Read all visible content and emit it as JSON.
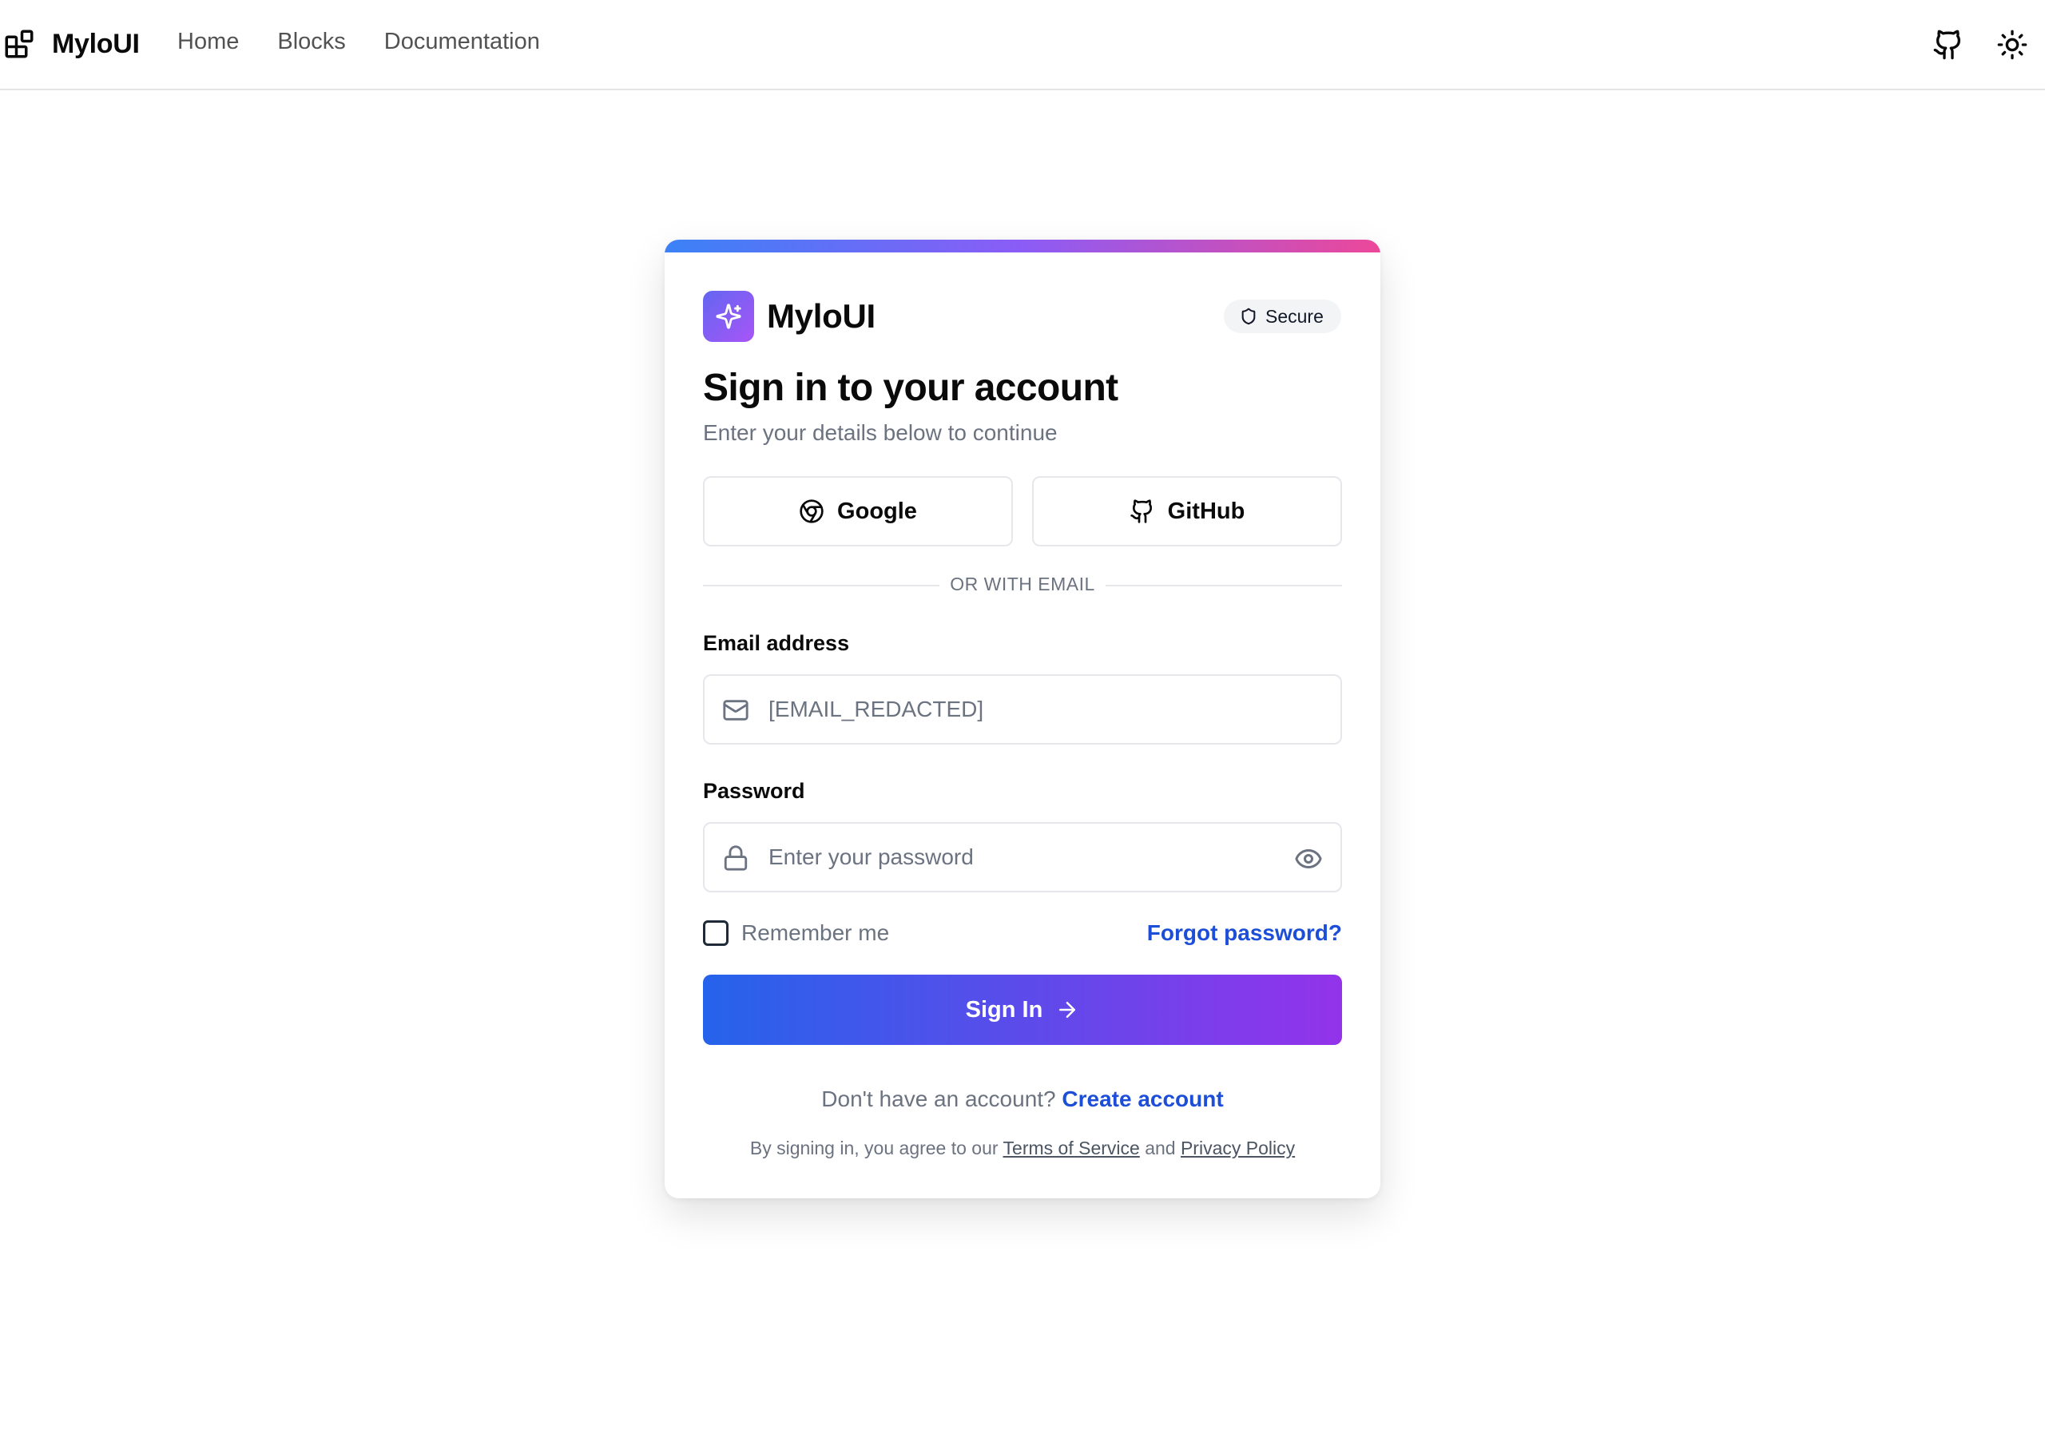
{
  "nav": {
    "brand": "MyloUI",
    "links": [
      "Home",
      "Blocks",
      "Documentation"
    ],
    "icons": {
      "github": "github-icon",
      "theme": "sun-icon"
    }
  },
  "card": {
    "brand": "MyloUI",
    "badge": "Secure",
    "title": "Sign in to your account",
    "subtitle": "Enter your details below to continue",
    "social": {
      "google": "Google",
      "github": "GitHub"
    },
    "divider": "OR WITH EMAIL",
    "email": {
      "label": "Email address",
      "value": "[EMAIL_REDACTED]"
    },
    "password": {
      "label": "Password",
      "placeholder": "Enter your password"
    },
    "remember": "Remember me",
    "forgot": "Forgot password?",
    "submit": "Sign In",
    "signup_prompt": "Don't have an account?",
    "signup_link": "Create account",
    "legal": {
      "prefix": "By signing in, you agree to our",
      "terms": "Terms of Service",
      "and": "and",
      "privacy": "Privacy Policy"
    }
  },
  "colors": {
    "accent_gradient": [
      "#3b82f6",
      "#8b5cf6",
      "#ec4899"
    ],
    "button_gradient": [
      "#2563eb",
      "#9333ea"
    ],
    "link": "#1d4ed8"
  }
}
